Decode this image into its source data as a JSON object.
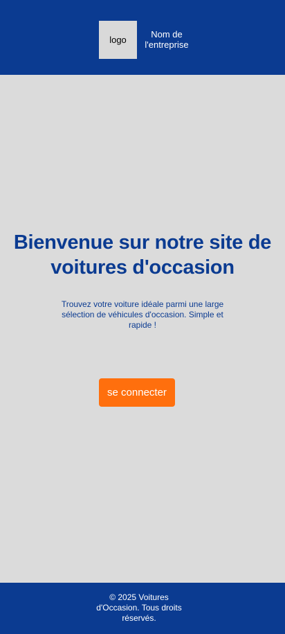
{
  "header": {
    "logo_text": "logo",
    "company_name": "Nom de l'entreprise"
  },
  "hero": {
    "title": "Bienvenue sur notre site de voitures d'occasion",
    "subtitle": "Trouvez votre voiture idéale parmi une large sélection de véhicules d'occasion. Simple et rapide !",
    "login_button_label": "se connecter"
  },
  "footer": {
    "copyright": "© 2025 Voitures d'Occasion. Tous droits réservés."
  },
  "colors": {
    "primary_blue": "#0b3b91",
    "accent_orange": "#ff6f0d",
    "background_gray": "#dbdbdb",
    "logo_placeholder": "#d9d9d9"
  }
}
